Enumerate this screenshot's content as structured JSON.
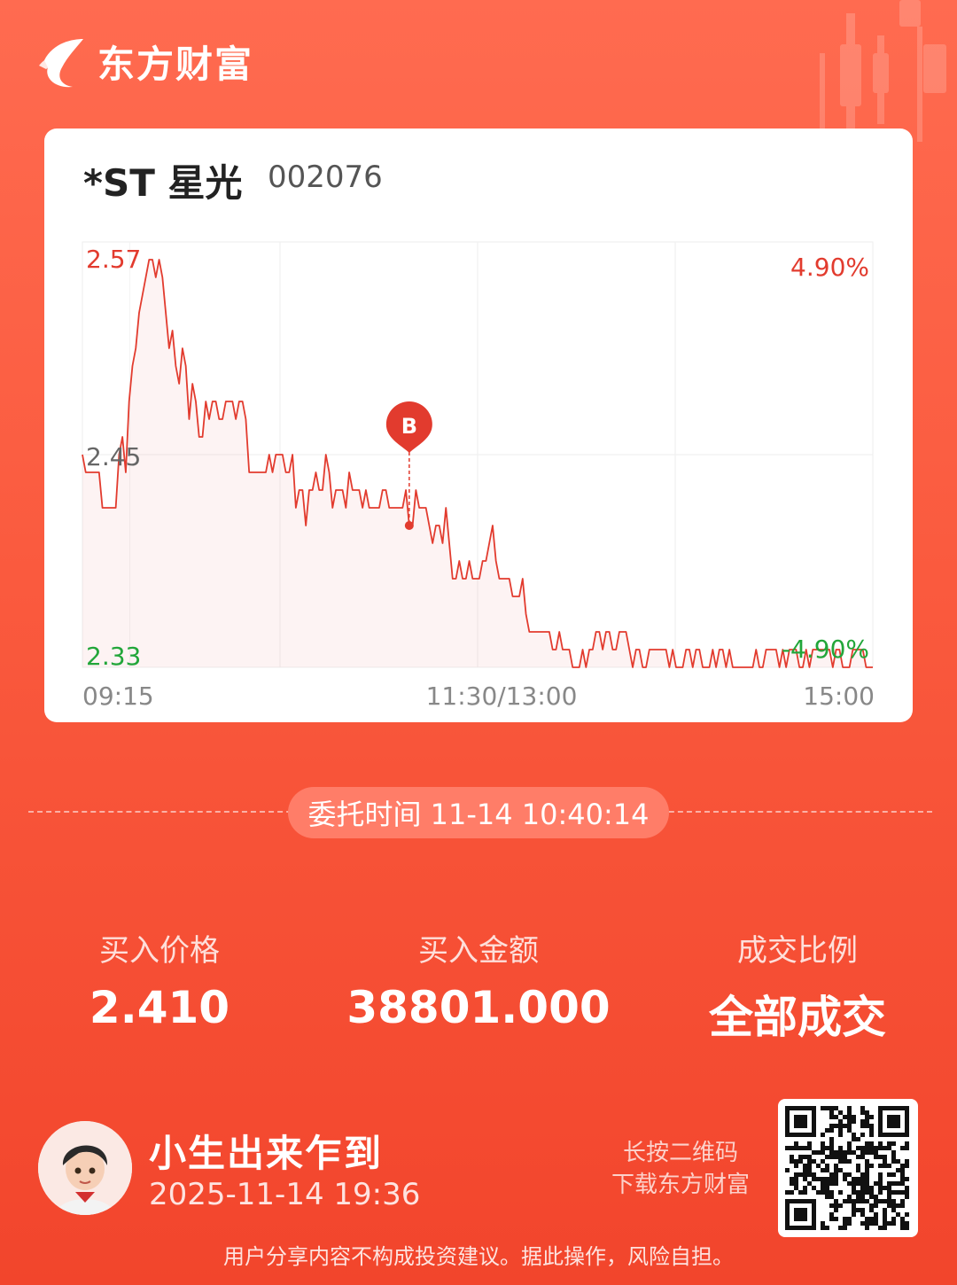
{
  "brand": {
    "name": "东方财富"
  },
  "stock": {
    "name": "*ST 星光",
    "code": "002076"
  },
  "colors": {
    "up": "#E23B2E",
    "down": "#22A63A",
    "neutral": "#666666",
    "bg": "#F84D33"
  },
  "chart_data": {
    "type": "line",
    "y_labels": {
      "high": "2.57",
      "mid": "2.45",
      "low": "2.33"
    },
    "pct_labels": {
      "high": "4.90%",
      "low": "-4.90%"
    },
    "x_labels": [
      "09:15",
      "11:30/13:00",
      "15:00"
    ],
    "ylim": [
      2.33,
      2.57
    ],
    "prev_close": 2.45,
    "marker": {
      "label": "B",
      "x_index": 98,
      "price": 2.41
    },
    "series": [
      {
        "values": [
          2.45,
          2.44,
          2.44,
          2.44,
          2.44,
          2.44,
          2.42,
          2.42,
          2.42,
          2.42,
          2.42,
          2.45,
          2.46,
          2.44,
          2.48,
          2.5,
          2.51,
          2.53,
          2.54,
          2.55,
          2.56,
          2.56,
          2.55,
          2.56,
          2.55,
          2.53,
          2.51,
          2.52,
          2.5,
          2.49,
          2.51,
          2.5,
          2.47,
          2.49,
          2.48,
          2.46,
          2.46,
          2.48,
          2.47,
          2.48,
          2.48,
          2.47,
          2.47,
          2.48,
          2.48,
          2.48,
          2.47,
          2.48,
          2.48,
          2.47,
          2.44,
          2.44,
          2.44,
          2.44,
          2.44,
          2.44,
          2.45,
          2.44,
          2.45,
          2.45,
          2.45,
          2.44,
          2.44,
          2.45,
          2.42,
          2.43,
          2.43,
          2.41,
          2.43,
          2.43,
          2.44,
          2.43,
          2.43,
          2.45,
          2.44,
          2.42,
          2.43,
          2.43,
          2.43,
          2.42,
          2.44,
          2.43,
          2.43,
          2.43,
          2.42,
          2.43,
          2.42,
          2.42,
          2.42,
          2.42,
          2.43,
          2.43,
          2.42,
          2.42,
          2.42,
          2.42,
          2.42,
          2.43,
          2.41,
          2.41,
          2.43,
          2.42,
          2.42,
          2.42,
          2.41,
          2.4,
          2.41,
          2.41,
          2.4,
          2.42,
          2.4,
          2.38,
          2.38,
          2.39,
          2.38,
          2.38,
          2.39,
          2.38,
          2.38,
          2.38,
          2.39,
          2.39,
          2.4,
          2.41,
          2.39,
          2.38,
          2.38,
          2.38,
          2.38,
          2.37,
          2.37,
          2.37,
          2.38,
          2.36,
          2.35,
          2.35,
          2.35,
          2.35,
          2.35,
          2.35,
          2.35,
          2.34,
          2.34,
          2.35,
          2.34,
          2.34,
          2.34,
          2.33,
          2.33,
          2.33,
          2.34,
          2.33,
          2.34,
          2.34,
          2.35,
          2.35,
          2.34,
          2.35,
          2.35,
          2.34,
          2.34,
          2.35,
          2.35,
          2.35,
          2.34,
          2.33,
          2.34,
          2.34,
          2.33,
          2.33,
          2.34,
          2.34,
          2.34,
          2.34,
          2.34,
          2.34,
          2.33,
          2.34,
          2.33,
          2.33,
          2.33,
          2.34,
          2.34,
          2.33,
          2.34,
          2.34,
          2.33,
          2.33,
          2.33,
          2.34,
          2.33,
          2.34,
          2.34,
          2.33,
          2.34,
          2.33,
          2.33,
          2.33,
          2.33,
          2.33,
          2.33,
          2.33,
          2.34,
          2.33,
          2.33,
          2.34,
          2.34,
          2.34,
          2.34,
          2.33,
          2.34,
          2.33,
          2.34,
          2.34,
          2.34,
          2.33,
          2.33,
          2.34,
          2.33,
          2.34,
          2.34,
          2.34,
          2.34,
          2.34,
          2.34,
          2.33,
          2.34,
          2.34,
          2.33,
          2.33,
          2.33,
          2.34,
          2.34,
          2.34,
          2.34,
          2.33,
          2.33,
          2.33
        ]
      }
    ]
  },
  "order": {
    "time_label": "委托时间 11-14 10:40:14"
  },
  "stats": [
    {
      "label": "买入价格",
      "value": "2.410"
    },
    {
      "label": "买入金额",
      "value": "38801.000"
    },
    {
      "label": "成交比例",
      "value": "全部成交"
    }
  ],
  "user": {
    "name": "小生出来乍到",
    "time": "2025-11-14 19:36"
  },
  "qr": {
    "hint_line1": "长按二维码",
    "hint_line2": "下载东方财富"
  },
  "disclaimer": "用户分享内容不构成投资建议。据此操作，风险自担。"
}
